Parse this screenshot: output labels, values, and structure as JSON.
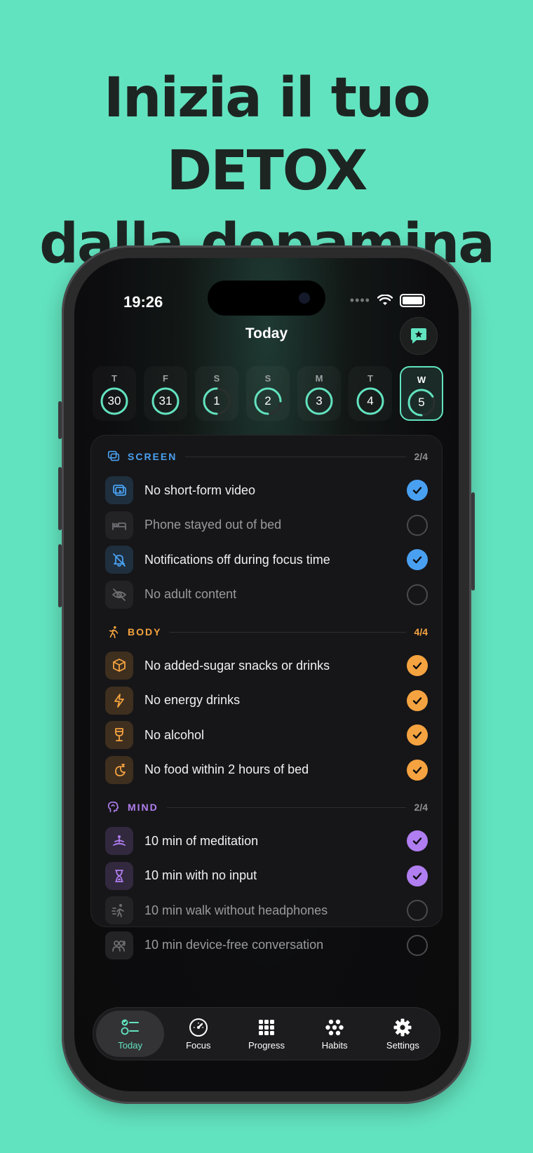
{
  "headline": {
    "line1": "Inizia il tuo DETOX",
    "line2": "dalla dopamina"
  },
  "status_bar": {
    "time": "19:26",
    "signal": "••••"
  },
  "nav": {
    "title": "Today",
    "chat_icon": "message-star-icon"
  },
  "days": [
    {
      "letter": "T",
      "number": "30",
      "progress": 1.0,
      "selected": false
    },
    {
      "letter": "F",
      "number": "31",
      "progress": 1.0,
      "selected": false
    },
    {
      "letter": "S",
      "number": "1",
      "progress": 0.5,
      "selected": false
    },
    {
      "letter": "S",
      "number": "2",
      "progress": 0.75,
      "selected": false
    },
    {
      "letter": "M",
      "number": "3",
      "progress": 1.0,
      "selected": false
    },
    {
      "letter": "T",
      "number": "4",
      "progress": 1.0,
      "selected": false
    },
    {
      "letter": "W",
      "number": "5",
      "progress": 0.67,
      "selected": true
    }
  ],
  "sections": [
    {
      "label": "SCREEN",
      "count": "2/4",
      "color": "#4aa0f0",
      "icon": "screens-icon",
      "tasks": [
        {
          "label": "No short-form video",
          "done": true,
          "icon": "video-icon"
        },
        {
          "label": "Phone stayed out of bed",
          "done": false,
          "icon": "bed-icon"
        },
        {
          "label": "Notifications off during focus time",
          "done": true,
          "icon": "bell-slash-icon"
        },
        {
          "label": "No adult content",
          "done": false,
          "icon": "eye-slash-icon"
        }
      ]
    },
    {
      "label": "BODY",
      "count": "4/4",
      "color": "#f5a340",
      "icon": "running-icon",
      "tasks": [
        {
          "label": "No added-sugar snacks or drinks",
          "done": true,
          "icon": "cube-icon"
        },
        {
          "label": "No energy drinks",
          "done": true,
          "icon": "bolt-icon"
        },
        {
          "label": "No alcohol",
          "done": true,
          "icon": "wine-glass-icon"
        },
        {
          "label": "No food within 2 hours of bed",
          "done": true,
          "icon": "moon-zzz-icon"
        }
      ]
    },
    {
      "label": "MIND",
      "count": "2/4",
      "color": "#b07ef0",
      "icon": "head-icon",
      "tasks": [
        {
          "label": "10 min of meditation",
          "done": true,
          "icon": "meditation-icon"
        },
        {
          "label": "10 min with no input",
          "done": true,
          "icon": "hourglass-icon"
        },
        {
          "label": "10 min walk without headphones",
          "done": false,
          "icon": "walking-icon"
        },
        {
          "label": "10 min device-free conversation",
          "done": false,
          "icon": "conversation-icon"
        }
      ]
    }
  ],
  "tabs": [
    {
      "label": "Today",
      "icon": "checklist-icon",
      "active": true
    },
    {
      "label": "Focus",
      "icon": "gauge-icon",
      "active": false
    },
    {
      "label": "Progress",
      "icon": "grid-icon",
      "active": false
    },
    {
      "label": "Habits",
      "icon": "dots-cluster-icon",
      "active": false
    },
    {
      "label": "Settings",
      "icon": "gear-icon",
      "active": false
    }
  ],
  "colors": {
    "accent": "#62e3bf",
    "screen": "#4aa0f0",
    "body": "#f5a340",
    "mind": "#b07ef0"
  }
}
